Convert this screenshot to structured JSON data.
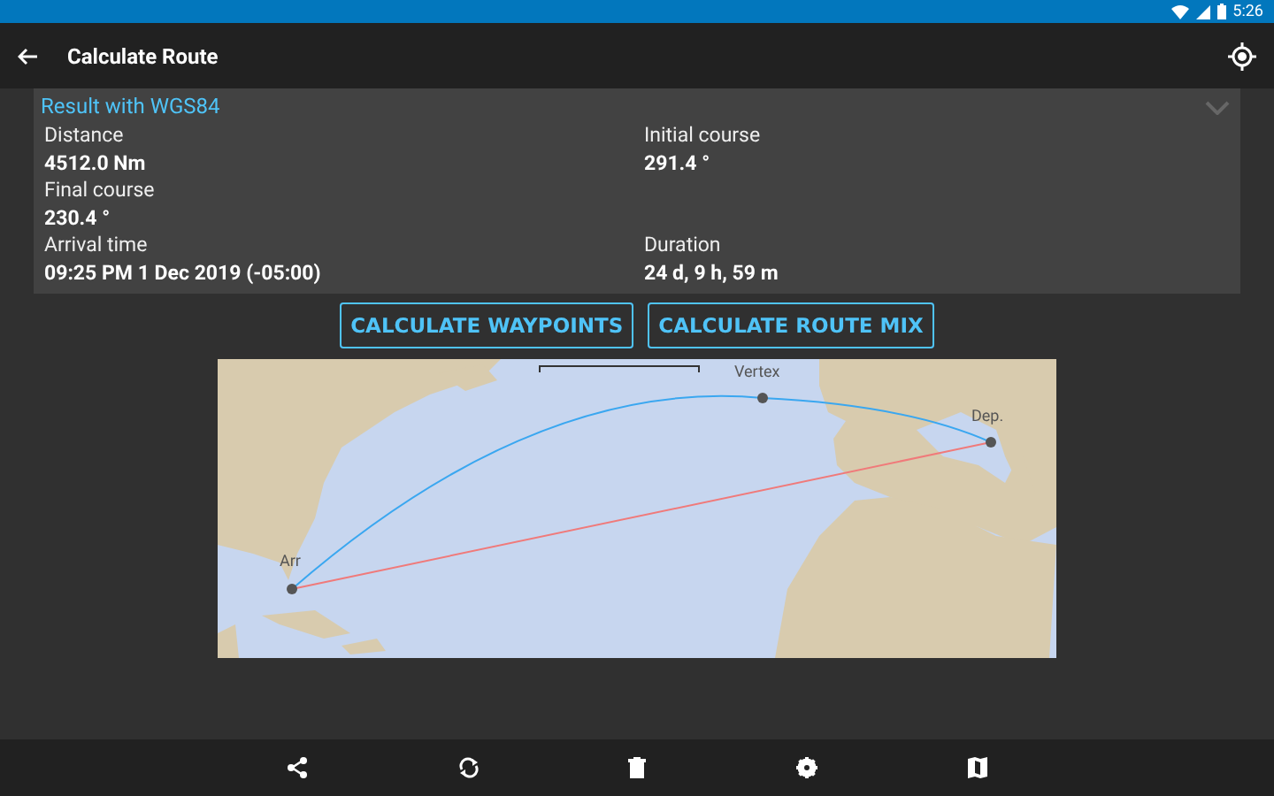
{
  "status_bar": {
    "time": "5:26"
  },
  "app_bar": {
    "title": "Calculate Route"
  },
  "result": {
    "title": "Result with WGS84",
    "expanded": true,
    "rows": [
      [
        {
          "label": "Distance",
          "value": "4512.0 Nm"
        },
        {
          "label": "Initial course",
          "value": "291.4 °"
        }
      ],
      [
        {
          "label": "Final course",
          "value": "230.4 °"
        }
      ],
      [
        {
          "label": "Arrival time",
          "value": "09:25 PM 1 Dec 2019 (-05:00)"
        },
        {
          "label": "Duration",
          "value": "24 d, 9 h, 59 m"
        }
      ]
    ]
  },
  "buttons": [
    "CALCULATE WAYPOINTS",
    "CALCULATE ROUTE MIX"
  ],
  "map": {
    "markers": [
      {
        "label": "Arr",
        "kind": "arrival"
      },
      {
        "label": "Vertex",
        "kind": "vertex"
      },
      {
        "label": "Dep.",
        "kind": "departure"
      }
    ]
  },
  "bottom_bar": {
    "actions": [
      {
        "kind": "share"
      },
      {
        "kind": "refresh"
      },
      {
        "kind": "delete"
      },
      {
        "kind": "settings"
      },
      {
        "kind": "map"
      }
    ]
  }
}
